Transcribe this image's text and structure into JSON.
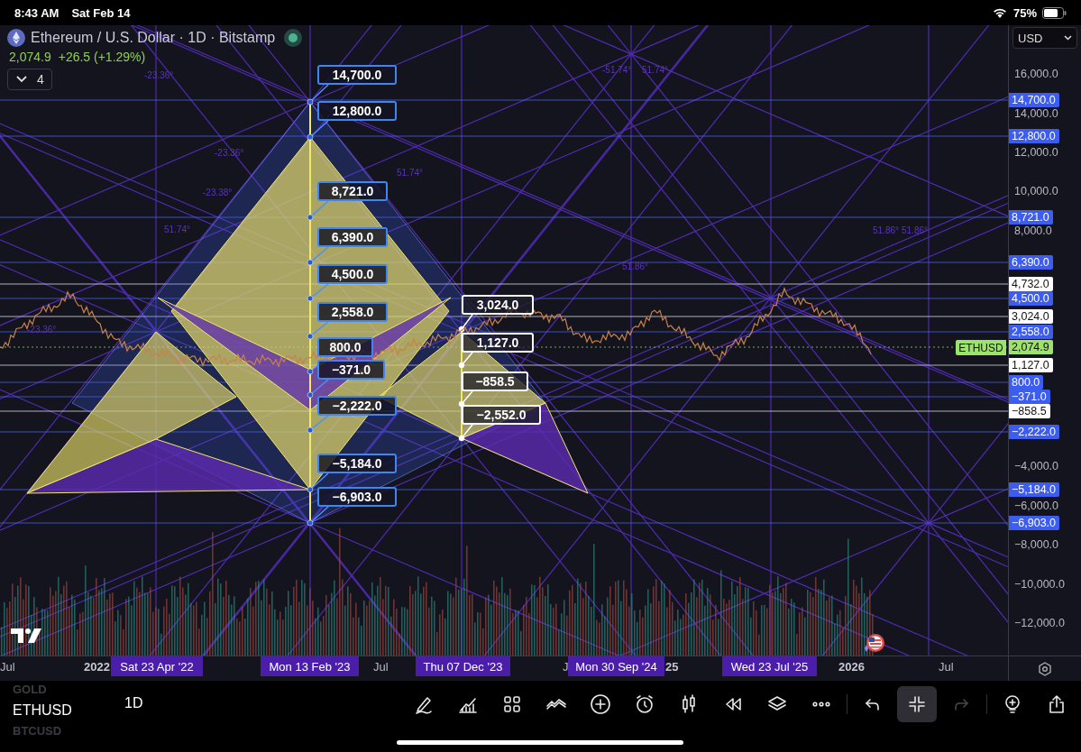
{
  "status_bar": {
    "time": "8:43 AM",
    "date": "Sat Feb 14",
    "battery": "75%"
  },
  "header": {
    "title": "Ethereum / U.S. Dollar · 1D · Bitstamp",
    "price": "2,074.9",
    "change": "+26.5 (+1.29%)",
    "indicator_count": "4"
  },
  "currency": "USD",
  "angle_labels": [
    "-23.36°",
    "-51.74°",
    "51.74°",
    "-23.36°",
    "-23.38°",
    "51.74°",
    "51.74°",
    "51.86°",
    "51.86°",
    "51.86°",
    "-23.36°"
  ],
  "callouts": [
    {
      "text": "14,700.0",
      "kind": "primary"
    },
    {
      "text": "12,800.0",
      "kind": "primary"
    },
    {
      "text": "8,721.0",
      "kind": "primary"
    },
    {
      "text": "6,390.0",
      "kind": "primary"
    },
    {
      "text": "4,500.0",
      "kind": "primary"
    },
    {
      "text": "2,558.0",
      "kind": "primary"
    },
    {
      "text": "800.0",
      "kind": "primary"
    },
    {
      "text": "−371.0",
      "kind": "primary"
    },
    {
      "text": "−2,222.0",
      "kind": "primary"
    },
    {
      "text": "−5,184.0",
      "kind": "primary"
    },
    {
      "text": "−6,903.0",
      "kind": "primary"
    },
    {
      "text": "3,024.0",
      "kind": "secondary"
    },
    {
      "text": "1,127.0",
      "kind": "secondary"
    },
    {
      "text": "−858.5",
      "kind": "secondary"
    },
    {
      "text": "−2,552.0",
      "kind": "secondary"
    }
  ],
  "last_price_tag": "ETHUSD",
  "price_axis": {
    "ticks": [
      "16,000.0",
      "14,000.0",
      "12,000.0",
      "10,000.0",
      "8,000.0",
      "−4,000.0",
      "−6,000.0",
      "−8,000.0",
      "−10,000.0",
      "−12,000.0"
    ],
    "badges": [
      {
        "text": "14,700.0",
        "kind": "level"
      },
      {
        "text": "12,800.0",
        "kind": "level"
      },
      {
        "text": "8,721.0",
        "kind": "level"
      },
      {
        "text": "6,390.0",
        "kind": "level"
      },
      {
        "text": "4,732.0",
        "kind": "marker"
      },
      {
        "text": "4,500.0",
        "kind": "level"
      },
      {
        "text": "3,024.0",
        "kind": "marker"
      },
      {
        "text": "2,558.0",
        "kind": "level"
      },
      {
        "text": "2,074.9",
        "kind": "last"
      },
      {
        "text": "1,127.0",
        "kind": "marker"
      },
      {
        "text": "800.0",
        "kind": "level"
      },
      {
        "text": "−371.0",
        "kind": "level"
      },
      {
        "text": "−858.5",
        "kind": "marker"
      },
      {
        "text": "−2,222.0",
        "kind": "level"
      },
      {
        "text": "−5,184.0",
        "kind": "level"
      },
      {
        "text": "−6,903.0",
        "kind": "level"
      }
    ]
  },
  "time_axis": [
    {
      "text": "Jul",
      "kind": "tick"
    },
    {
      "text": "2022",
      "kind": "year"
    },
    {
      "text": "Sat 23 Apr '22",
      "kind": "marker"
    },
    {
      "text": "Mon 13 Feb '23",
      "kind": "marker"
    },
    {
      "text": "Jul",
      "kind": "tick"
    },
    {
      "text": "Thu 07 Dec '23",
      "kind": "marker"
    },
    {
      "text": "J",
      "kind": "tick"
    },
    {
      "text": "Mon 30 Sep '24",
      "kind": "marker"
    },
    {
      "text": "25",
      "kind": "year"
    },
    {
      "text": "Wed 23 Jul '25",
      "kind": "marker"
    },
    {
      "text": "2026",
      "kind": "year"
    },
    {
      "text": "Jul",
      "kind": "tick"
    }
  ],
  "toolbar": {
    "symbols": [
      {
        "text": "GOLD",
        "selected": false
      },
      {
        "text": "ETHUSD",
        "selected": true
      },
      {
        "text": "BTCUSD",
        "selected": false
      }
    ],
    "interval": "1D",
    "tools": [
      {
        "kind": "pen",
        "selected": false,
        "disabled": false
      },
      {
        "kind": "indicators",
        "selected": false,
        "disabled": false
      },
      {
        "kind": "grid",
        "selected": false,
        "disabled": false
      },
      {
        "kind": "compare",
        "selected": false,
        "disabled": false
      },
      {
        "kind": "add",
        "selected": false,
        "disabled": false
      },
      {
        "kind": "alert",
        "selected": false,
        "disabled": false
      },
      {
        "kind": "candles",
        "selected": false,
        "disabled": false
      },
      {
        "kind": "replay",
        "selected": false,
        "disabled": false
      },
      {
        "kind": "layers",
        "selected": false,
        "disabled": false
      },
      {
        "kind": "more",
        "selected": false,
        "disabled": false
      },
      {
        "kind": "undo",
        "selected": false,
        "disabled": false
      },
      {
        "kind": "collapse",
        "selected": true,
        "disabled": false
      },
      {
        "kind": "redo",
        "selected": false,
        "disabled": true
      },
      {
        "kind": "idea",
        "selected": false,
        "disabled": false
      },
      {
        "kind": "share",
        "selected": false,
        "disabled": false
      }
    ]
  }
}
